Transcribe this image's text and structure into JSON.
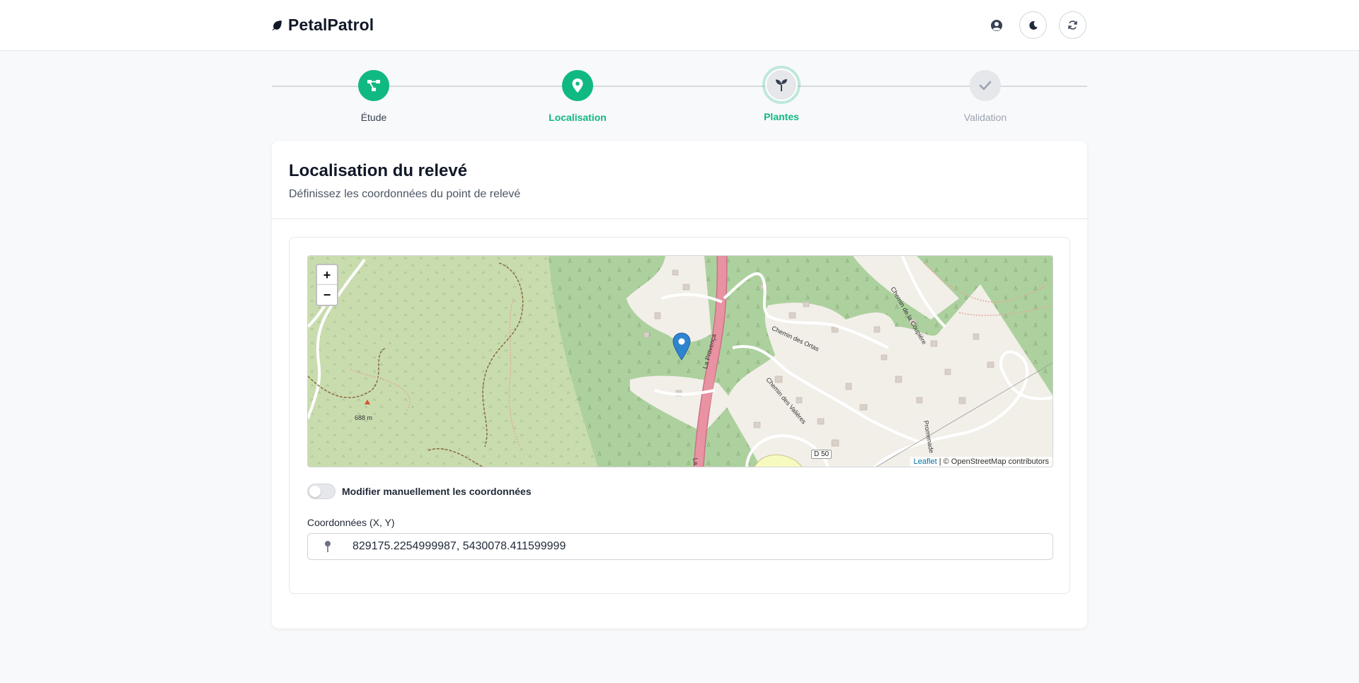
{
  "header": {
    "brand": "PetalPatrol",
    "colors": {
      "accent": "#10b981",
      "text": "#111827"
    },
    "icons": {
      "brand": "leaf-icon",
      "user": "user-circle-icon",
      "theme": "moon-icon",
      "refresh": "refresh-icon"
    }
  },
  "stepper": {
    "steps": [
      {
        "label": "Étude",
        "state": "completed",
        "icon": "hierarchy-icon"
      },
      {
        "label": "Localisation",
        "state": "active",
        "icon": "map-pin-icon"
      },
      {
        "label": "Plantes",
        "state": "next",
        "icon": "sprout-icon"
      },
      {
        "label": "Validation",
        "state": "upcoming",
        "icon": "check-icon"
      }
    ]
  },
  "card": {
    "title": "Localisation du relevé",
    "subtitle": "Définissez les coordonnées du point de relevé"
  },
  "map": {
    "zoom_in": "+",
    "zoom_out": "−",
    "attribution_link": "Leaflet",
    "attribution_text": " | © OpenStreetMap contributors",
    "labels": {
      "elevation": "688 m",
      "road_badge": "D 50",
      "road_main": "La Provença",
      "road_main_south": "La Prov",
      "street_1": "Chemin des Ortas",
      "street_2": "Chemin des Valières",
      "street_3": "Chemin de la Coupière",
      "street_4": "Promenade"
    },
    "icons": {
      "marker": "map-marker-icon"
    }
  },
  "manual_toggle": {
    "label": "Modifier manuellement les coordonnées",
    "checked": false
  },
  "coordinates": {
    "label": "Coordonnées (X, Y)",
    "value": "829175.2254999987, 5430078.411599999",
    "icon": "pin-icon"
  }
}
